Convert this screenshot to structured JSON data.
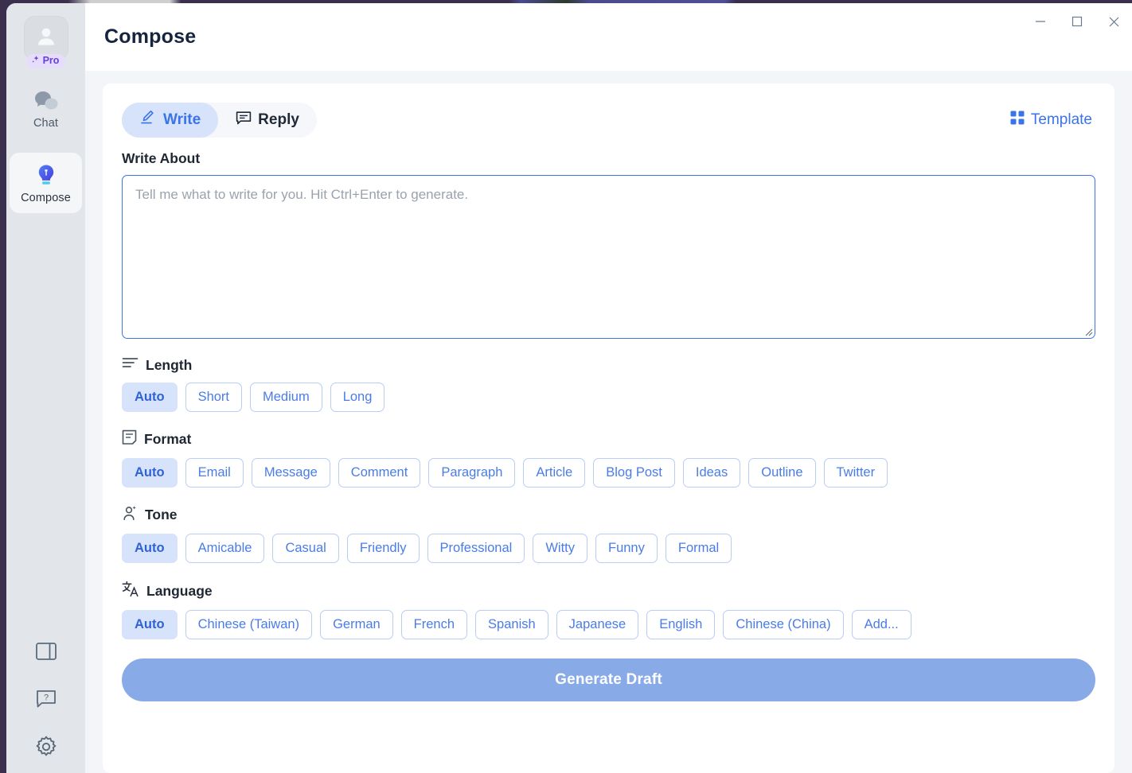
{
  "window": {
    "title": "Compose",
    "controls": [
      {
        "name": "minimize",
        "glyph": "minimize-icon"
      },
      {
        "name": "maximize",
        "glyph": "maximize-icon"
      },
      {
        "name": "close",
        "glyph": "close-icon"
      }
    ]
  },
  "sidebar": {
    "avatar": {
      "icon": "user-avatar-icon",
      "badge": "Pro",
      "badge_icon": "sparkle-icon"
    },
    "items": [
      {
        "label": "Chat",
        "icon": "chat-bubbles-icon",
        "active": false
      },
      {
        "label": "Compose",
        "icon": "lightbulb-icon",
        "active": true
      }
    ],
    "bottom": [
      {
        "icon": "sidebar-panel-icon"
      },
      {
        "icon": "help-question-icon"
      },
      {
        "icon": "gear-icon"
      }
    ]
  },
  "compose": {
    "modes": [
      {
        "label": "Write",
        "icon": "write-pen-icon",
        "active": true
      },
      {
        "label": "Reply",
        "icon": "reply-bubble-icon",
        "active": false
      }
    ],
    "template_label": "Template",
    "template_icon": "grid-icon",
    "write_about_label": "Write About",
    "textarea_value": "",
    "textarea_placeholder": "Tell me what to write for you. Hit Ctrl+Enter to generate.",
    "groups": [
      {
        "title": "Length",
        "icon": "lines-icon",
        "options": [
          "Auto",
          "Short",
          "Medium",
          "Long"
        ],
        "selected": "Auto"
      },
      {
        "title": "Format",
        "icon": "document-icon",
        "options": [
          "Auto",
          "Email",
          "Message",
          "Comment",
          "Paragraph",
          "Article",
          "Blog Post",
          "Ideas",
          "Outline",
          "Twitter"
        ],
        "selected": "Auto"
      },
      {
        "title": "Tone",
        "icon": "person-sparkle-icon",
        "options": [
          "Auto",
          "Amicable",
          "Casual",
          "Friendly",
          "Professional",
          "Witty",
          "Funny",
          "Formal"
        ],
        "selected": "Auto"
      },
      {
        "title": "Language",
        "icon": "translate-icon",
        "options": [
          "Auto",
          "Chinese (Taiwan)",
          "German",
          "French",
          "Spanish",
          "Japanese",
          "English",
          "Chinese (China)",
          "Add..."
        ],
        "selected": "Auto"
      }
    ],
    "generate_label": "Generate Draft"
  },
  "colors": {
    "accent": "#3b73e8",
    "chip_selected_bg": "#d7e3fa",
    "generate_bg": "#88abe8",
    "sidebar_bg": "#e2e6ea",
    "pro_purple": "#6741d9"
  }
}
